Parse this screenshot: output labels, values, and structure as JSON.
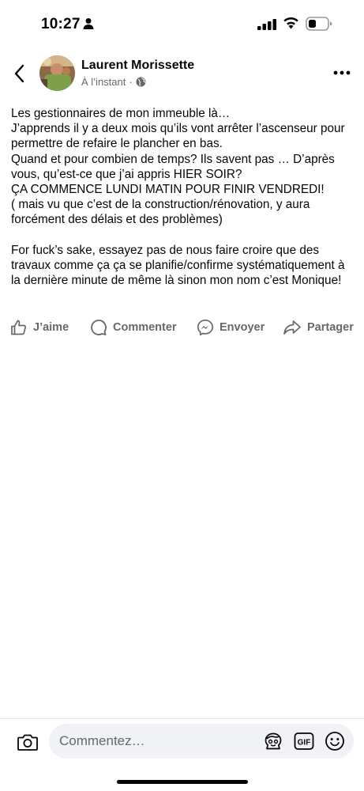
{
  "status_bar": {
    "time": "10:27"
  },
  "post": {
    "author": "Laurent Morissette",
    "timestamp": "À l’instant",
    "separator": "·",
    "visibility_icon": "globe-icon",
    "paragraphs": [
      "Les gestionnaires de mon immeuble là…",
      "J’apprends il y a deux mois qu’ils vont arrêter l’ascenseur pour permettre de refaire le plancher en bas.",
      "Quand et pour combien de temps? Ils savent pas … D’après vous, qu’est-ce que j’ai appris HIER SOIR?",
      "ÇA COMMENCE LUNDI MATIN POUR FINIR VENDREDI!",
      "( mais vu que c’est de la construction/rénovation, y aura forcément des délais et des problèmes)",
      "For fuck’s sake, essayez pas de nous faire croire que des travaux comme ça ça se planifie/confirme systématiquement à la dernière minute de même là sinon mon nom c’est Monique!"
    ]
  },
  "actions": {
    "like": "J’aime",
    "comment": "Commenter",
    "send": "Envoyer",
    "share": "Partager"
  },
  "comment_bar": {
    "placeholder": "Commentez…",
    "gif_label": "GIF"
  },
  "colors": {
    "text": "#050505",
    "secondary": "#65676b",
    "input_bg": "#f0f2f5"
  }
}
